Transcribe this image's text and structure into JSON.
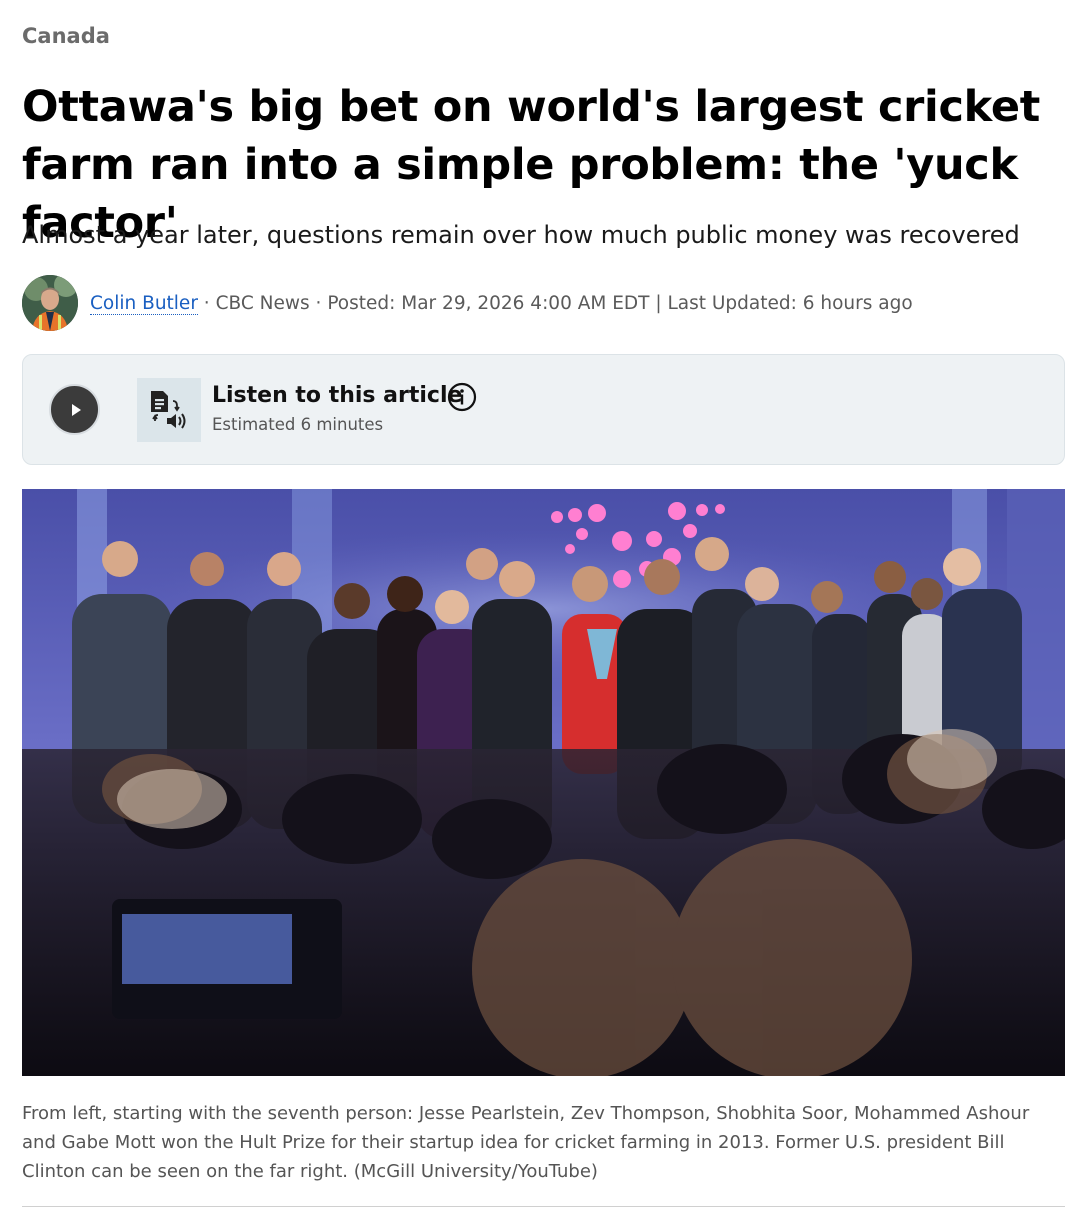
{
  "article": {
    "section": "Canada",
    "headline": "Ottawa's big bet on world's largest cricket farm ran into a simple problem: the 'yuck factor'",
    "subheadline": "Almost a year later, questions remain over how much public money was recovered",
    "byline": {
      "author": "Colin Butler",
      "separator1": " · ",
      "outlet": "CBC News",
      "separator2": " · ",
      "posted": "Posted: Mar 29, 2026 4:00 AM EDT | Last Updated: 6 hours ago"
    },
    "listen": {
      "title": "Listen to this article",
      "estimate": "Estimated 6 minutes",
      "play_icon": "play-icon",
      "audio_icon": "text-to-speech-icon",
      "info_icon": "info-icon"
    },
    "photo": {
      "description_icon": "photo"
    },
    "caption": "From left, starting with the seventh person: Jesse Pearlstein, Zev Thompson, Shobhita Soor, Mohammed Ashour and Gabe Mott won the Hult Prize for their startup idea for cricket farming in 2013. Former U.S. president Bill Clinton can be seen on the far right. (McGill University/YouTube)"
  },
  "colors": {
    "link": "#1a5fc1",
    "section_label": "#6b6b6b",
    "card_bg": "#eef2f4",
    "play_button": "#3b3b3b"
  }
}
